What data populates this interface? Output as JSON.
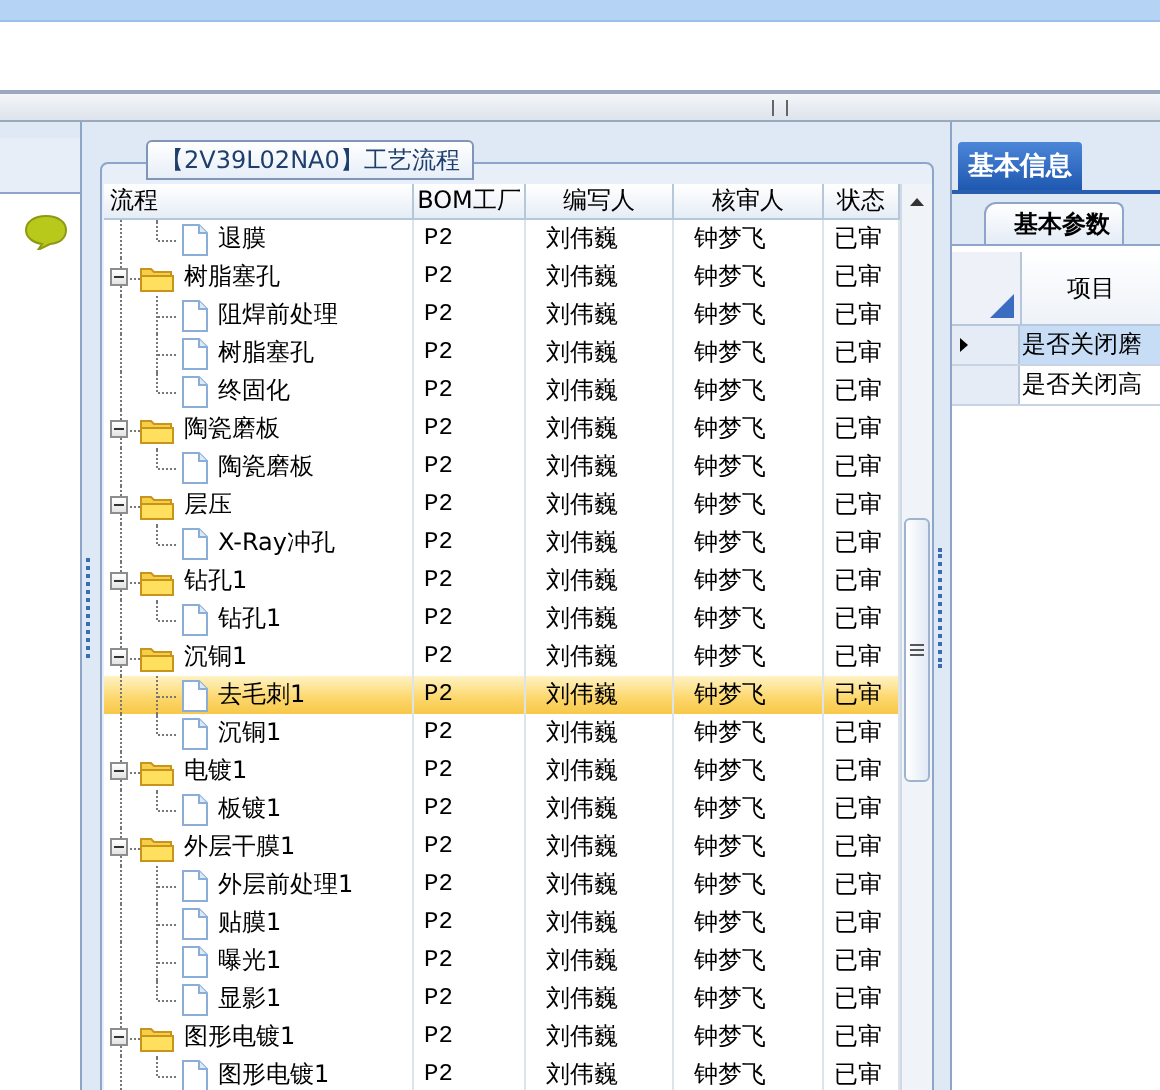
{
  "process_panel": {
    "tab": "【2V39L02NA0】工艺流程",
    "columns": [
      "流程",
      "BOM工厂",
      "编写人",
      "核审人",
      "状态"
    ],
    "tree": [
      {
        "kind": "continuation",
        "children": [
          {
            "kind": "step",
            "name": "退膜",
            "bom": "P2",
            "writer": "刘伟巍",
            "reviewer": "钟梦飞",
            "status": "已审",
            "selected": false
          }
        ]
      },
      {
        "kind": "folder",
        "name": "树脂塞孔",
        "bom": "P2",
        "writer": "刘伟巍",
        "reviewer": "钟梦飞",
        "status": "已审",
        "selected": false,
        "expanded": true,
        "children": [
          {
            "kind": "step",
            "name": "阻焊前处理",
            "bom": "P2",
            "writer": "刘伟巍",
            "reviewer": "钟梦飞",
            "status": "已审",
            "selected": false
          },
          {
            "kind": "step",
            "name": "树脂塞孔",
            "bom": "P2",
            "writer": "刘伟巍",
            "reviewer": "钟梦飞",
            "status": "已审",
            "selected": false
          },
          {
            "kind": "step",
            "name": "终固化",
            "bom": "P2",
            "writer": "刘伟巍",
            "reviewer": "钟梦飞",
            "status": "已审",
            "selected": false
          }
        ]
      },
      {
        "kind": "folder",
        "name": "陶瓷磨板",
        "bom": "P2",
        "writer": "刘伟巍",
        "reviewer": "钟梦飞",
        "status": "已审",
        "selected": false,
        "expanded": true,
        "children": [
          {
            "kind": "step",
            "name": "陶瓷磨板",
            "bom": "P2",
            "writer": "刘伟巍",
            "reviewer": "钟梦飞",
            "status": "已审",
            "selected": false
          }
        ]
      },
      {
        "kind": "folder",
        "name": "层压",
        "bom": "P2",
        "writer": "刘伟巍",
        "reviewer": "钟梦飞",
        "status": "已审",
        "selected": false,
        "expanded": true,
        "children": [
          {
            "kind": "step",
            "name": "X-Ray冲孔",
            "bom": "P2",
            "writer": "刘伟巍",
            "reviewer": "钟梦飞",
            "status": "已审",
            "selected": false
          }
        ]
      },
      {
        "kind": "folder",
        "name": "钻孔1",
        "bom": "P2",
        "writer": "刘伟巍",
        "reviewer": "钟梦飞",
        "status": "已审",
        "selected": false,
        "expanded": true,
        "children": [
          {
            "kind": "step",
            "name": "钻孔1",
            "bom": "P2",
            "writer": "刘伟巍",
            "reviewer": "钟梦飞",
            "status": "已审",
            "selected": false
          }
        ]
      },
      {
        "kind": "folder",
        "name": "沉铜1",
        "bom": "P2",
        "writer": "刘伟巍",
        "reviewer": "钟梦飞",
        "status": "已审",
        "selected": false,
        "expanded": true,
        "children": [
          {
            "kind": "step",
            "name": "去毛刺1",
            "bom": "P2",
            "writer": "刘伟巍",
            "reviewer": "钟梦飞",
            "status": "已审",
            "selected": true
          },
          {
            "kind": "step",
            "name": "沉铜1",
            "bom": "P2",
            "writer": "刘伟巍",
            "reviewer": "钟梦飞",
            "status": "已审",
            "selected": false
          }
        ]
      },
      {
        "kind": "folder",
        "name": "电镀1",
        "bom": "P2",
        "writer": "刘伟巍",
        "reviewer": "钟梦飞",
        "status": "已审",
        "selected": false,
        "expanded": true,
        "children": [
          {
            "kind": "step",
            "name": "板镀1",
            "bom": "P2",
            "writer": "刘伟巍",
            "reviewer": "钟梦飞",
            "status": "已审",
            "selected": false
          }
        ]
      },
      {
        "kind": "folder",
        "name": "外层干膜1",
        "bom": "P2",
        "writer": "刘伟巍",
        "reviewer": "钟梦飞",
        "status": "已审",
        "selected": false,
        "expanded": true,
        "children": [
          {
            "kind": "step",
            "name": "外层前处理1",
            "bom": "P2",
            "writer": "刘伟巍",
            "reviewer": "钟梦飞",
            "status": "已审",
            "selected": false
          },
          {
            "kind": "step",
            "name": "贴膜1",
            "bom": "P2",
            "writer": "刘伟巍",
            "reviewer": "钟梦飞",
            "status": "已审",
            "selected": false
          },
          {
            "kind": "step",
            "name": "曝光1",
            "bom": "P2",
            "writer": "刘伟巍",
            "reviewer": "钟梦飞",
            "status": "已审",
            "selected": false
          },
          {
            "kind": "step",
            "name": "显影1",
            "bom": "P2",
            "writer": "刘伟巍",
            "reviewer": "钟梦飞",
            "status": "已审",
            "selected": false
          }
        ]
      },
      {
        "kind": "folder",
        "name": "图形电镀1",
        "bom": "P2",
        "writer": "刘伟巍",
        "reviewer": "钟梦飞",
        "status": "已审",
        "selected": false,
        "expanded": true,
        "children": [
          {
            "kind": "step",
            "name": "图形电镀1",
            "bom": "P2",
            "writer": "刘伟巍",
            "reviewer": "钟梦飞",
            "status": "已审",
            "selected": false
          }
        ]
      }
    ]
  },
  "info_panel": {
    "tabs": [
      {
        "label": "基本信息",
        "selected": true
      }
    ],
    "subtabs": [
      {
        "label": "基本参数",
        "selected": true
      }
    ],
    "column": "项目",
    "rows": [
      {
        "item": "是否关闭磨",
        "selected": true
      },
      {
        "item": "是否关闭高",
        "selected": false
      }
    ]
  }
}
